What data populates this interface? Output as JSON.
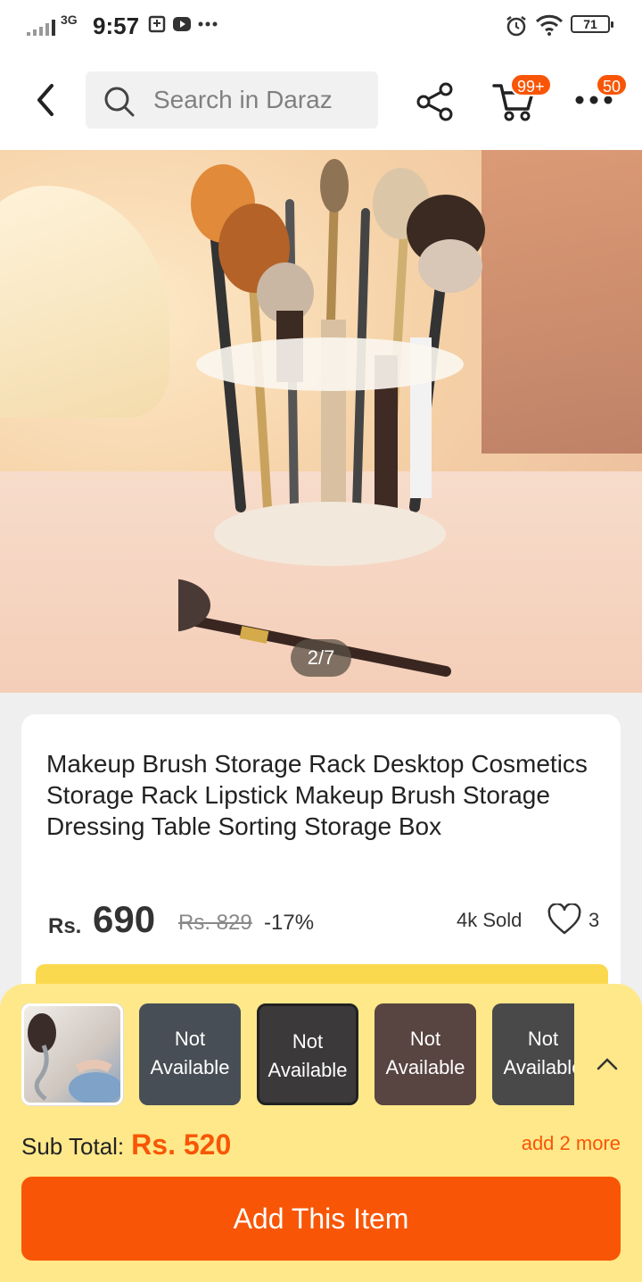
{
  "status_bar": {
    "network": "3G",
    "time": "9:57",
    "battery": "71"
  },
  "header": {
    "search_placeholder": "Search in Daraz",
    "cart_badge": "99+",
    "more_badge": "50"
  },
  "gallery": {
    "page_indicator": "2/7"
  },
  "product": {
    "title": "Makeup Brush Storage Rack Desktop Cosmetics Storage Rack Lipstick Makeup Brush Storage Dressing Table Sorting Storage Box",
    "currency": "Rs.",
    "price": "690",
    "original_price": "Rs. 829",
    "discount": "-17%",
    "sold": "4k Sold",
    "wishlist_count": "3"
  },
  "bundle": {
    "thumbs": [
      {
        "overlay": ""
      },
      {
        "overlay": "Not Available"
      },
      {
        "overlay": "Not Available"
      },
      {
        "overlay": "Not Available"
      },
      {
        "overlay": "Not Available"
      }
    ],
    "subtotal_label": "Sub Total:",
    "subtotal_amount": "Rs. 520",
    "add_more": "add 2 more",
    "add_button": "Add This Item"
  },
  "colors": {
    "accent": "#f85606",
    "sheet_bg": "#fee88a"
  }
}
